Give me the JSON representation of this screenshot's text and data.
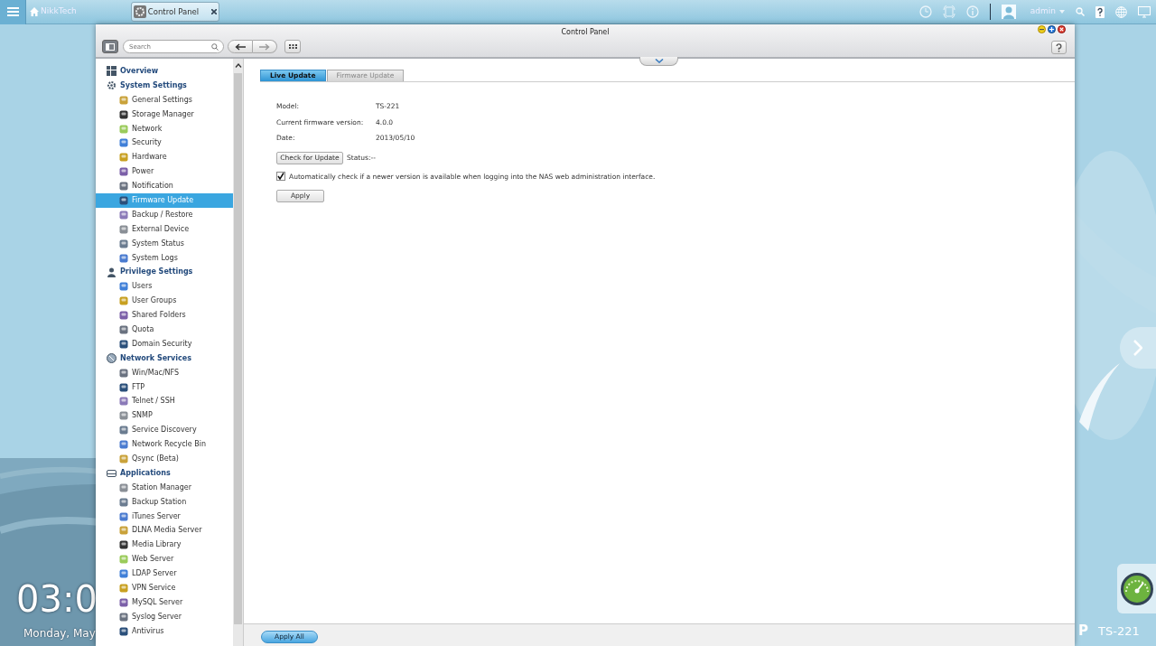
{
  "taskbar": {
    "home_label": "NikkTech",
    "tabs": [
      {
        "label": "Control Panel",
        "selected": true
      }
    ],
    "user": "admin"
  },
  "desktop": {
    "clock": "03:0",
    "date": "Monday, May",
    "brand_fragment": "P",
    "model_label": "TS-221"
  },
  "window": {
    "title": "Control Panel",
    "search": {
      "placeholder": "Search"
    },
    "sidebar": {
      "items": [
        {
          "label": "Overview",
          "selected": false
        },
        {
          "label": "System Settings",
          "selected": false,
          "children": [
            {
              "label": "General Settings",
              "selected": false
            },
            {
              "label": "Storage Manager",
              "selected": false
            },
            {
              "label": "Network",
              "selected": false
            },
            {
              "label": "Security",
              "selected": false
            },
            {
              "label": "Hardware",
              "selected": false
            },
            {
              "label": "Power",
              "selected": false
            },
            {
              "label": "Notification",
              "selected": false
            },
            {
              "label": "Firmware Update",
              "selected": true
            },
            {
              "label": "Backup / Restore",
              "selected": false
            },
            {
              "label": "External Device",
              "selected": false
            },
            {
              "label": "System Status",
              "selected": false
            },
            {
              "label": "System Logs",
              "selected": false
            }
          ]
        },
        {
          "label": "Privilege Settings",
          "selected": false,
          "children": [
            {
              "label": "Users",
              "selected": false
            },
            {
              "label": "User Groups",
              "selected": false
            },
            {
              "label": "Shared Folders",
              "selected": false
            },
            {
              "label": "Quota",
              "selected": false
            },
            {
              "label": "Domain Security",
              "selected": false
            }
          ]
        },
        {
          "label": "Network Services",
          "selected": false,
          "children": [
            {
              "label": "Win/Mac/NFS",
              "selected": false
            },
            {
              "label": "FTP",
              "selected": false
            },
            {
              "label": "Telnet / SSH",
              "selected": false
            },
            {
              "label": "SNMP",
              "selected": false
            },
            {
              "label": "Service Discovery",
              "selected": false
            },
            {
              "label": "Network Recycle Bin",
              "selected": false
            },
            {
              "label": "Qsync (Beta)",
              "selected": false
            }
          ]
        },
        {
          "label": "Applications",
          "selected": false,
          "children": [
            {
              "label": "Station Manager",
              "selected": false
            },
            {
              "label": "Backup Station",
              "selected": false
            },
            {
              "label": "iTunes Server",
              "selected": false
            },
            {
              "label": "DLNA Media Server",
              "selected": false
            },
            {
              "label": "Media Library",
              "selected": false
            },
            {
              "label": "Web Server",
              "selected": false
            },
            {
              "label": "LDAP Server",
              "selected": false
            },
            {
              "label": "VPN Service",
              "selected": false
            },
            {
              "label": "MySQL Server",
              "selected": false
            },
            {
              "label": "Syslog Server",
              "selected": false
            },
            {
              "label": "Antivirus",
              "selected": false
            }
          ]
        }
      ]
    },
    "tabs": [
      {
        "label": "Live Update",
        "selected": true
      },
      {
        "label": "Firmware Update",
        "selected": false
      }
    ],
    "fields": [
      {
        "label": "Model:",
        "value": "TS-221"
      },
      {
        "label": "Current firmware version:",
        "value": "4.0.0"
      },
      {
        "label": "Date:",
        "value": "2013/05/10"
      }
    ],
    "check_button": "Check for Update",
    "status": "Status:--",
    "auto_check": {
      "label": "Automatically check if a newer version is available when logging into the NAS web administration interface.",
      "checked": true
    },
    "apply_button": "Apply",
    "apply_all_button": "Apply All"
  }
}
